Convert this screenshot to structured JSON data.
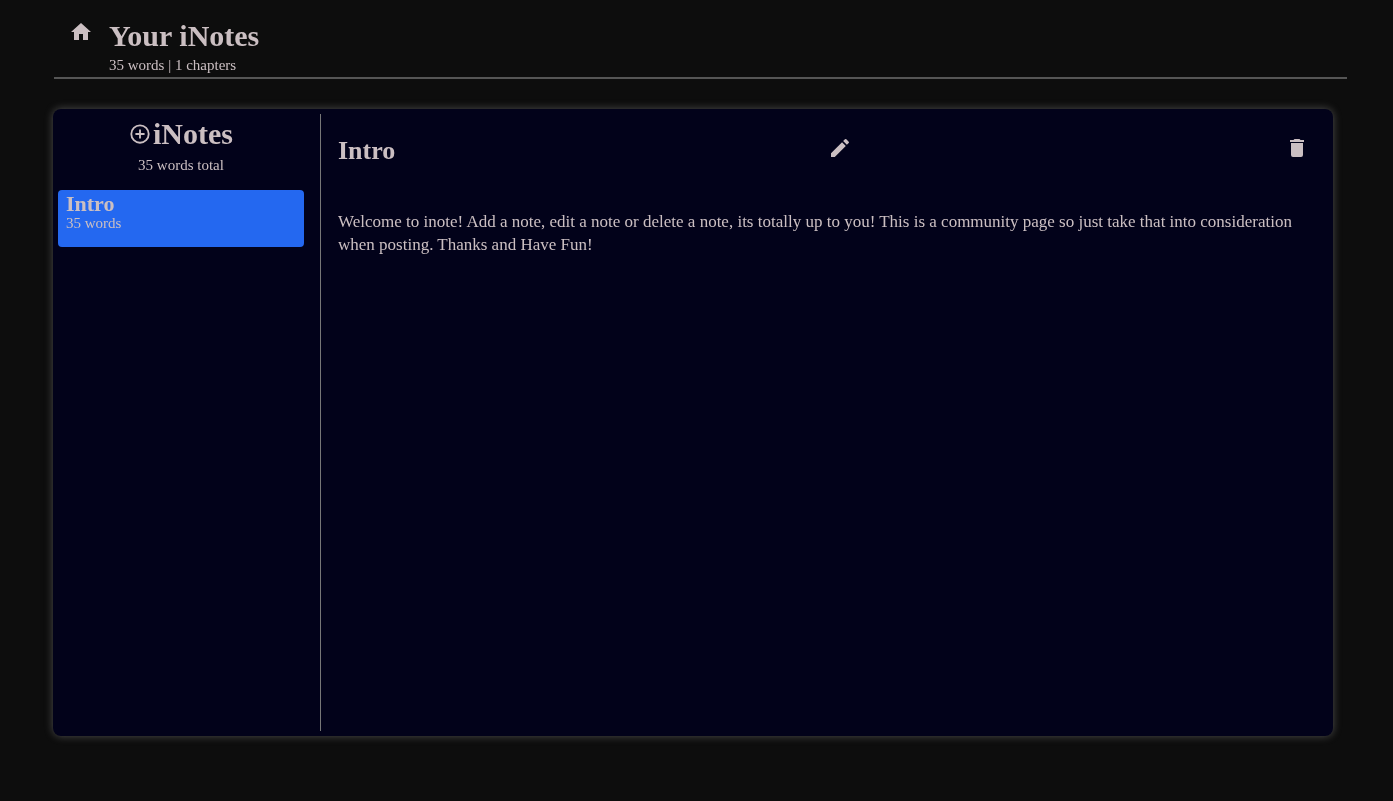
{
  "header": {
    "title": "Your iNotes",
    "stats": "35 words | 1 chapters"
  },
  "sidebar": {
    "title": "iNotes",
    "total": "35 words total",
    "notes": [
      {
        "title": "Intro",
        "words": "35 words",
        "selected": true
      }
    ]
  },
  "editor": {
    "title": "Intro",
    "body": "Welcome to inote! Add a note, edit a note or delete a note, its totally up to you! This is a community page so just take that into consideration when posting. Thanks and Have Fun!"
  }
}
